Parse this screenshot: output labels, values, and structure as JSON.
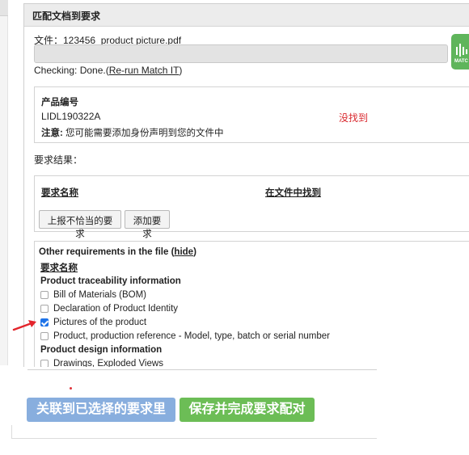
{
  "dialog": {
    "title": "匹配文档到要求",
    "file_line": "文件：123456_product picture.pdf",
    "progress": 1.0,
    "checking_prefix": "Checking: Done.(",
    "rerun_link": "Re-run Match IT",
    "checking_suffix": ")",
    "match_button_text": "MATC"
  },
  "product": {
    "label": "产品编号",
    "code": "LIDL190322A",
    "status": "没找到",
    "status_color": "#d9282e",
    "note_bold": "注意:",
    "note_text": " 您可能需要添加身份声明到您的文件中"
  },
  "results": {
    "label": "要求结果：",
    "col_name": "要求名称",
    "col_found": "在文件中找到",
    "report_button": "上报不恰当的要求",
    "add_button": "添加要求"
  },
  "other": {
    "title_prefix": "Other requirements in the file (",
    "hide_link": "hide",
    "title_suffix": ")",
    "col_name": "要求名称",
    "sections": [
      {
        "name": "Product traceability information",
        "items": [
          {
            "label": "Bill of Materials (BOM)",
            "checked": false
          },
          {
            "label": "Declaration of Product Identity",
            "checked": false
          },
          {
            "label": "Pictures of the product",
            "checked": true
          },
          {
            "label": "Product, production reference - Model, type, batch or serial number",
            "checked": false
          }
        ]
      },
      {
        "name": "Product design information",
        "items": [
          {
            "label": "Drawings, Exploded Views",
            "checked": false
          }
        ]
      }
    ]
  },
  "footer": {
    "link_button": "关联到已选择的要求里",
    "link_button_color": "#88aede",
    "save_button": "保存并完成要求配对",
    "save_button_color": "#6cbd56"
  },
  "icons": {
    "annotation": "red-arrow-icon",
    "match": "match-it-logo-icon"
  }
}
